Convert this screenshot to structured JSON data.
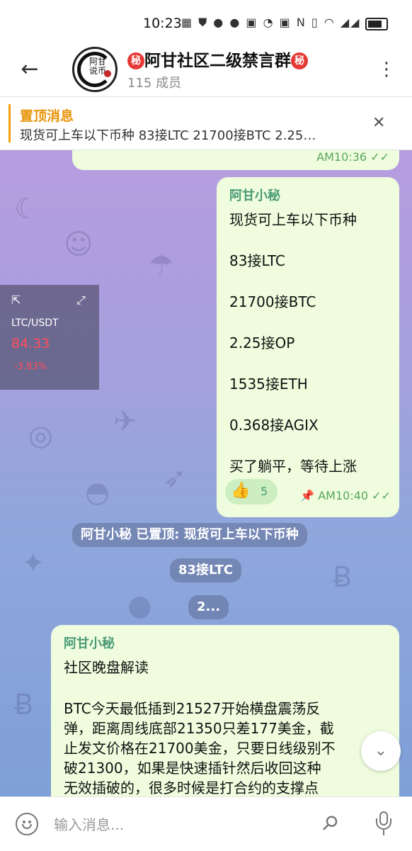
{
  "status": {
    "time": "10:23",
    "battery_level": 0.8,
    "icons": [
      "app-icon",
      "shield-icon",
      "chat-icon",
      "chat-icon",
      "chip-icon",
      "speed-icon",
      "chip-icon",
      "nfc-icon",
      "vibrate-icon",
      "wifi-icon",
      "signal-icon",
      "signal-icon",
      "battery-icon"
    ]
  },
  "header": {
    "title": "阿甘社区二级禁言群",
    "title_badge": "秘",
    "members": "115 成员",
    "avatar_text": "阿甘说币"
  },
  "pinned": {
    "label": "置顶消息",
    "text": "现货可上车以下币种  83接LTC  21700接BTC  2.25…"
  },
  "chat": {
    "prev_time": "AM10:36",
    "message1": {
      "sender": "阿甘小秘",
      "lines": [
        "现货可上车以下币种",
        "83接LTC",
        "21700接BTC",
        "2.25接OP",
        "1535接ETH",
        "0.368接AGIX",
        "买了躺平，等待上涨"
      ],
      "reaction_emoji": "👍",
      "reaction_count": "5",
      "time": "AM10:40"
    },
    "service": [
      "阿甘小秘 已置顶: 现货可上车以下币种",
      "83接LTC",
      "2..."
    ],
    "message2": {
      "sender": "阿甘小秘",
      "lines": [
        "社区晚盘解读",
        "BTC今天最低插到21527开始横盘震荡反",
        "弹，距离周线底部21350只差177美金，截",
        "止发文价格在21700美金，只要日线级别不",
        "破21300，如果是快速插针然后收回这种",
        "无效插破的，很多时候是打合约的支撑点"
      ]
    }
  },
  "ticker": {
    "pair": "LTC/USDT",
    "price": "84.33",
    "change": "-3.83%"
  },
  "input": {
    "placeholder": "输入消息..."
  },
  "colors": {
    "accent": "#4a9a76",
    "pinned": "#e8950c",
    "bubble": "#effdde",
    "negative": "#ff4d5a"
  }
}
